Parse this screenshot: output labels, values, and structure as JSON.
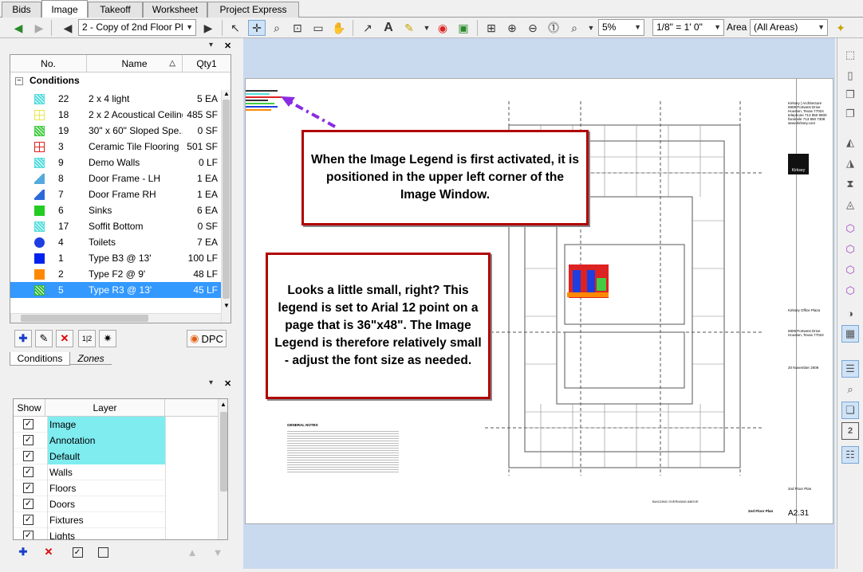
{
  "tabs": [
    {
      "label": "Bids",
      "active": false
    },
    {
      "label": "Image",
      "active": true
    },
    {
      "label": "Takeoff",
      "active": false
    },
    {
      "label": "Worksheet",
      "active": false
    },
    {
      "label": "Project Express",
      "active": false
    }
  ],
  "toolbar": {
    "page_select": "2 - Copy of 2nd Floor Pl",
    "zoom": "5%",
    "scale": "1/8\" = 1' 0\"",
    "area_label": "Area",
    "area_select": "(All Areas)"
  },
  "conditions": {
    "col_no": "No.",
    "col_name": "Name",
    "col_qty": "Qty1",
    "group": "Conditions",
    "expand_symbol": "−",
    "rows": [
      {
        "no": "22",
        "name": "2 x 4 light",
        "qty": "5 EA",
        "color": "#55dddd",
        "shape": "hatch"
      },
      {
        "no": "18",
        "name": "2 x 2 Acoustical Ceiling",
        "qty": "485 SF",
        "color": "#e8e84a",
        "shape": "grid"
      },
      {
        "no": "19",
        "name": "30\" x 60\" Sloped Spe...",
        "qty": "0 SF",
        "color": "#44cc44",
        "shape": "hatch"
      },
      {
        "no": "3",
        "name": "Ceramic Tile Flooring",
        "qty": "501 SF",
        "color": "#dd2222",
        "shape": "grid"
      },
      {
        "no": "9",
        "name": "Demo Walls",
        "qty": "0 LF",
        "color": "#55dddd",
        "shape": "hatch"
      },
      {
        "no": "8",
        "name": "Door Frame - LH",
        "qty": "1 EA",
        "color": "#55aadd",
        "shape": "door"
      },
      {
        "no": "7",
        "name": "Door Frame RH",
        "qty": "1 EA",
        "color": "#2a6adb",
        "shape": "door"
      },
      {
        "no": "6",
        "name": "Sinks",
        "qty": "6 EA",
        "color": "#22cc22",
        "shape": "solid"
      },
      {
        "no": "17",
        "name": "Soffit Bottom",
        "qty": "0 SF",
        "color": "#55dddd",
        "shape": "hatch"
      },
      {
        "no": "4",
        "name": "Toilets",
        "qty": "7 EA",
        "color": "#1d3ee0",
        "shape": "circle"
      },
      {
        "no": "1",
        "name": "Type B3 @ 13'",
        "qty": "100 LF",
        "color": "#0022ee",
        "shape": "solid"
      },
      {
        "no": "2",
        "name": "Type F2 @ 9'",
        "qty": "48 LF",
        "color": "#ff8800",
        "shape": "solid"
      },
      {
        "no": "5",
        "name": "Type R3 @ 13'",
        "qty": "45 LF",
        "color": "#33bb33",
        "shape": "hatch",
        "selected": true
      }
    ],
    "dpc_label": "DPC",
    "tab_conditions": "Conditions",
    "tab_zones": "Zones"
  },
  "layers": {
    "col_show": "Show",
    "col_layer": "Layer",
    "check_mark": "✓",
    "rows": [
      {
        "name": "Image",
        "highlight": true
      },
      {
        "name": "Annotation",
        "highlight": true
      },
      {
        "name": "Default",
        "highlight": true
      },
      {
        "name": "Walls",
        "highlight": false
      },
      {
        "name": "Floors",
        "highlight": false
      },
      {
        "name": "Doors",
        "highlight": false
      },
      {
        "name": "Fixtures",
        "highlight": false
      },
      {
        "name": "Lights",
        "highlight": false
      }
    ]
  },
  "callouts": {
    "top": "When the Image Legend is first activated, it is positioned in the upper left corner of the Image Window.",
    "bottom": "Looks a little small, right? This legend is set to Arial 12 point on a page that is 36\"x48\".  The Image Legend is therefore relatively small - adjust the font size as needed."
  },
  "sheet": {
    "firm": "Kirksey | Architecture",
    "firm_addr": "6909 Portwest Drive\nHouston, Texas 77024\ntelephone 713 850 9600\nfacsimile 713 850 7308\nwww.kirksey.com",
    "logo": "Kirksey",
    "project": "Kirksey Office Plaza",
    "project_addr": "6909 Portwest Drive\nHouston, Texas 77024",
    "date": "20 November 2009",
    "sheet_title": "2nd Floor Plan",
    "sheet_no": "A2.31",
    "plan_label": "2nd Floor Plan",
    "notes_title": "GENERAL NOTES",
    "building": "BUILDING OVERHANG ABOVE"
  },
  "colors": {
    "accent": "#b00000",
    "legend_arrow": "#8a2be2",
    "selected": "#3399ff",
    "layer_highlight": "#7fecf0"
  }
}
